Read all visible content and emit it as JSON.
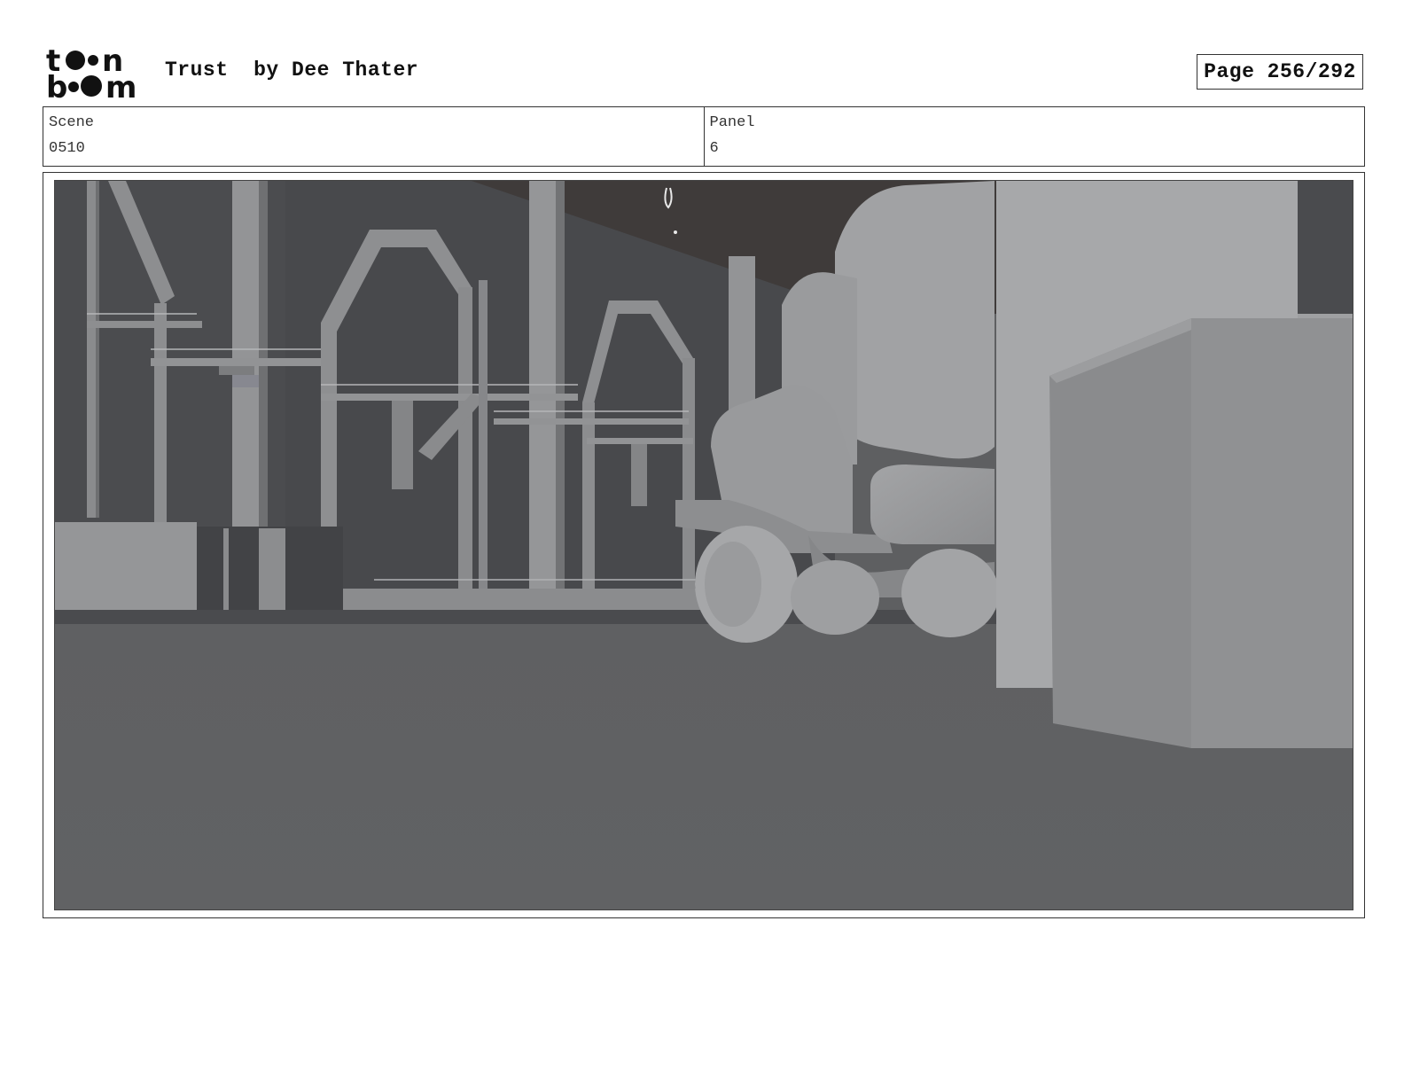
{
  "header": {
    "logo_label": "toonboom",
    "title": "Trust  by Dee Thater",
    "page_indicator": "Page 256/292"
  },
  "info": {
    "scene_label": "Scene",
    "scene_value": "0510",
    "panel_label": "Panel",
    "panel_value": "6"
  },
  "panel_image": {
    "icon": "storyboard-render-image",
    "palette": {
      "sky": "#3e3a39",
      "wall": "#48494c",
      "structure": "#8d8e90",
      "ground": "#5e5f61",
      "truck": "#9b9c9e",
      "crate": "#8a8b8d"
    }
  }
}
